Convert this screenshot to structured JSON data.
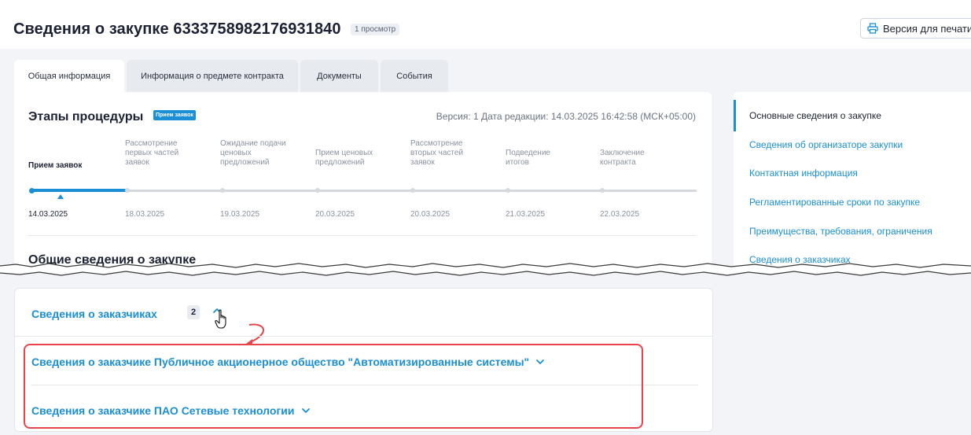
{
  "header": {
    "title": "Сведения о закупке 6333758982176931840",
    "views": "1 просмотр",
    "print_label": "Версия для печати"
  },
  "tabs": [
    {
      "label": "Общая информация",
      "active": true
    },
    {
      "label": "Информация о предмете контракта",
      "active": false
    },
    {
      "label": "Документы",
      "active": false
    },
    {
      "label": "События",
      "active": false
    }
  ],
  "stages": {
    "title": "Этапы процедуры",
    "badge": "Прием заявок",
    "version": "Версия: 1 Дата редакции: 14.03.2025 16:42:58 (МСК+05:00)",
    "items": [
      {
        "label": "Прием заявок",
        "date": "14.03.2025",
        "active": true
      },
      {
        "label": "Рассмотрение первых частей заявок",
        "date": "18.03.2025",
        "active": false
      },
      {
        "label": "Ожидание подачи ценовых предложений",
        "date": "19.03.2025",
        "active": false
      },
      {
        "label": "Прием ценовых предложений",
        "date": "20.03.2025",
        "active": false
      },
      {
        "label": "Рассмотрение вторых частей заявок",
        "date": "20.03.2025",
        "active": false
      },
      {
        "label": "Подведение итогов",
        "date": "21.03.2025",
        "active": false
      },
      {
        "label": "Заключение контракта",
        "date": "22.03.2025",
        "active": false
      }
    ]
  },
  "general": {
    "title": "Общие сведения о закупке"
  },
  "sidebar": {
    "items": [
      {
        "label": "Основные сведения о закупке",
        "current": true
      },
      {
        "label": "Сведения об организаторе закупки",
        "current": false
      },
      {
        "label": "Контактная информация",
        "current": false
      },
      {
        "label": "Регламентированные сроки по закупке",
        "current": false
      },
      {
        "label": "Преимущества, требования, ограничения",
        "current": false
      },
      {
        "label": "Сведения о заказчиках",
        "current": false
      }
    ]
  },
  "customers": {
    "title": "Сведения о заказчиках",
    "count": "2",
    "items": [
      {
        "label": "Сведения о заказчике Публичное акционерное общество \"Автоматизированные системы\""
      },
      {
        "label": "Сведения о заказчике ПАО Сетевые технологии"
      }
    ]
  },
  "colors": {
    "accent": "#1a8fd6",
    "highlight": "#e8444a",
    "background": "#f2f4f7"
  }
}
